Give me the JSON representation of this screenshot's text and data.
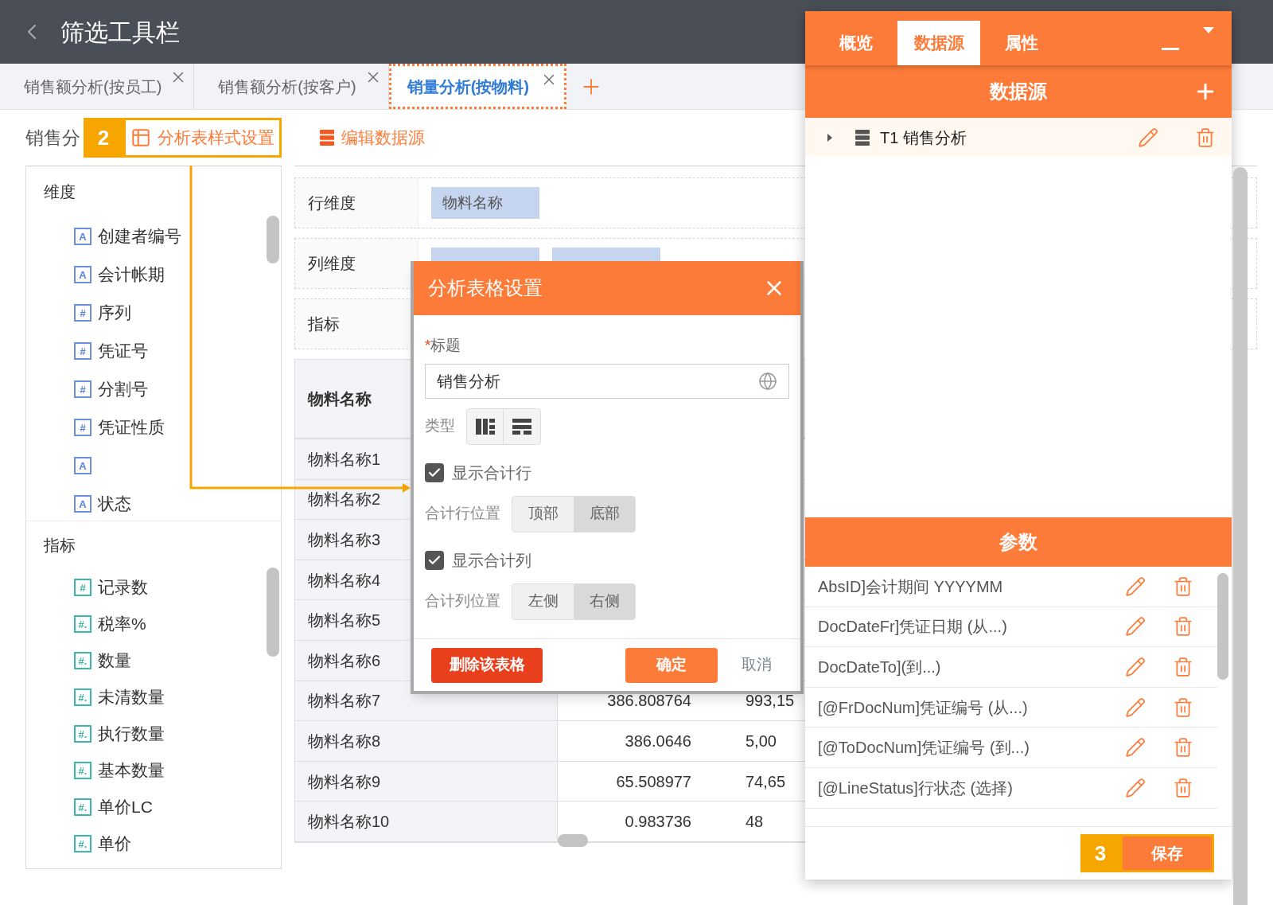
{
  "header": {
    "title": "筛选工具栏"
  },
  "tabs": [
    {
      "label": "销售额分析(按员工)",
      "selected": false
    },
    {
      "label": "销售额分析(按客户)",
      "selected": false
    },
    {
      "label": "销量分析(按物料)",
      "selected": true
    }
  ],
  "toolbar": {
    "title": "销售分",
    "callout": "2",
    "buttons": [
      {
        "kind": "table",
        "label": "分析表样式设置",
        "highlighted": true
      },
      {
        "kind": "source",
        "label": "编辑数据源",
        "highlighted": false
      }
    ]
  },
  "field_list": {
    "sections": [
      {
        "kind": "dimension",
        "title": "维度",
        "items": [
          {
            "badge": "A",
            "label": "创建者编号"
          },
          {
            "badge": "A",
            "label": "会计帐期"
          },
          {
            "badge": "#",
            "label": "序列"
          },
          {
            "badge": "#",
            "label": "凭证号"
          },
          {
            "badge": "#",
            "label": "分割号"
          },
          {
            "badge": "#",
            "label": "凭证性质"
          },
          {
            "badge": "A"
          },
          {
            "badge": "A",
            "label": "状态"
          }
        ]
      },
      {
        "kind": "measure",
        "title": "指标",
        "items": [
          {
            "badge": "#",
            "label": "记录数"
          },
          {
            "badge": "#.",
            "label": "税率%"
          },
          {
            "badge": "#.",
            "label": "数量"
          },
          {
            "badge": "#.",
            "label": "未清数量"
          },
          {
            "badge": "#.",
            "label": "执行数量"
          },
          {
            "badge": "#.",
            "label": "基本数量"
          },
          {
            "badge": "#.",
            "label": "单价LC"
          },
          {
            "badge": "#.",
            "label": "单价"
          }
        ]
      }
    ]
  },
  "zones": [
    {
      "label": "行维度",
      "chips": [
        {
          "kind": "label",
          "text": "物料名称"
        }
      ]
    },
    {
      "label": "列维度",
      "chips": [
        {
          "kind": "covered"
        },
        {
          "kind": "covered"
        }
      ]
    },
    {
      "label": "指标"
    }
  ],
  "table": {
    "columns": [
      "物料名称"
    ],
    "rows": [
      {
        "cells": [
          "物料名称1"
        ]
      },
      {
        "cells": [
          "物料名称2"
        ]
      },
      {
        "cells": [
          "物料名称3"
        ]
      },
      {
        "cells": [
          "物料名称4"
        ]
      },
      {
        "cells": [
          "物料名称5"
        ]
      },
      {
        "cells": [
          "物料名称6"
        ]
      },
      {
        "cells": [
          "物料名称7",
          "386.808764",
          "993,15"
        ]
      },
      {
        "cells": [
          "物料名称8",
          "386.0646",
          "5,00"
        ]
      },
      {
        "cells": [
          "物料名称9",
          "65.508977",
          "74,65"
        ]
      },
      {
        "cells": [
          "物料名称10",
          "0.983736",
          "48"
        ]
      }
    ]
  },
  "dialog": {
    "title": "分析表格设置",
    "title_field": {
      "required_mark": "*",
      "label": "标题",
      "value": "销售分析"
    },
    "type_label": "类型",
    "options": [
      {
        "label": "显示合计行",
        "checked": true,
        "position_label": "合计行位置",
        "choices": [
          {
            "label": "顶部",
            "selected": false
          },
          {
            "label": "底部",
            "selected": true
          }
        ]
      },
      {
        "label": "显示合计列",
        "checked": true,
        "position_label": "合计列位置",
        "choices": [
          {
            "label": "左侧",
            "selected": false
          },
          {
            "label": "右侧",
            "selected": true
          }
        ]
      }
    ],
    "buttons": [
      {
        "kind": "danger",
        "label": "删除该表格"
      },
      {
        "kind": "primary",
        "label": "确定"
      },
      {
        "kind": "text",
        "label": "取消"
      }
    ]
  },
  "panel": {
    "tabs": [
      {
        "label": "概览",
        "selected": false
      },
      {
        "label": "数据源",
        "selected": true
      },
      {
        "label": "属性",
        "selected": false
      }
    ],
    "sources_title": "数据源",
    "sources": [
      {
        "label": "T1 销售分析"
      }
    ],
    "params_title": "参数",
    "params": [
      "AbsID]会计期间 YYYYMM",
      "DocDateFr]凭证日期 (从...)",
      "DocDateTo](到...)",
      "[@FrDocNum]凭证编号 (从...)",
      "[@ToDocNum]凭证编号 (到...)",
      "[@LineStatus]行状态 (选择)"
    ],
    "save": {
      "label": "保存",
      "callout": "3"
    }
  }
}
